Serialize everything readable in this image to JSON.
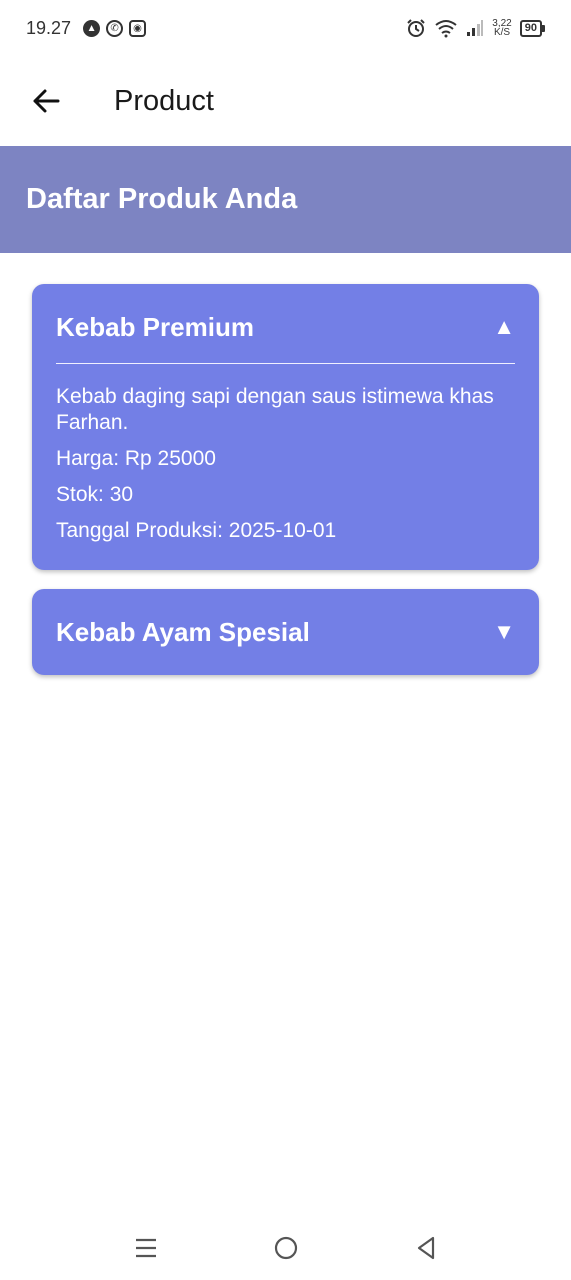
{
  "status_bar": {
    "time": "19.27",
    "net_speed_value": "3,22",
    "net_speed_unit": "K/S",
    "battery": "90"
  },
  "app_bar": {
    "title": "Product",
    "back_icon": "arrow-left-icon"
  },
  "banner": {
    "title": "Daftar Produk Anda"
  },
  "products": [
    {
      "name": "Kebab Premium",
      "expanded": true,
      "toggle_glyph": "▲",
      "description": "Kebab daging sapi dengan saus istimewa khas Farhan.",
      "price": "Harga: Rp 25000",
      "stock": "Stok: 30",
      "production_date": "Tanggal Produksi: 2025-10-01"
    },
    {
      "name": "Kebab Ayam Spesial",
      "expanded": false,
      "toggle_glyph": "▼"
    }
  ],
  "colors": {
    "banner": "#7d84c2",
    "card": "#737fe6",
    "text_on_accent": "#ffffff"
  },
  "nav_bar": {
    "icons": [
      "menu-icon",
      "home-icon",
      "back-triangle-icon"
    ]
  }
}
